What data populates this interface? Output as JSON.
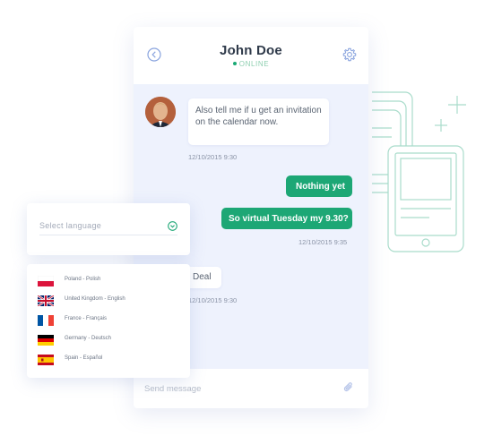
{
  "chat": {
    "contact_name": "John Doe",
    "status": "ONLINE",
    "messages": [
      {
        "direction": "incoming",
        "text": "Also tell me if u get an invitation on the calendar now.",
        "timestamp": "12/10/2015 9:30"
      },
      {
        "direction": "outgoing",
        "text": "Nothing yet",
        "timestamp": ""
      },
      {
        "direction": "outgoing",
        "text": "So virtual Tuesday my 9.30?",
        "timestamp": "12/10/2015 9:35"
      },
      {
        "direction": "incoming",
        "text": "Deal",
        "timestamp": "12/10/2015 9:30"
      }
    ],
    "input_placeholder": "Send message"
  },
  "language_select": {
    "label": "Select language",
    "options": [
      {
        "label": "Poland - Polish",
        "flag": "poland"
      },
      {
        "label": "United Kingdom - English",
        "flag": "united-kingdom"
      },
      {
        "label": "France - Français",
        "flag": "france"
      },
      {
        "label": "Germany - Deutsch",
        "flag": "germany"
      },
      {
        "label": "Spain - Español",
        "flag": "spain"
      }
    ]
  },
  "colors": {
    "accent": "#1da775",
    "chat_background": "#eef2fd",
    "decoration": "#9fd8c6"
  }
}
